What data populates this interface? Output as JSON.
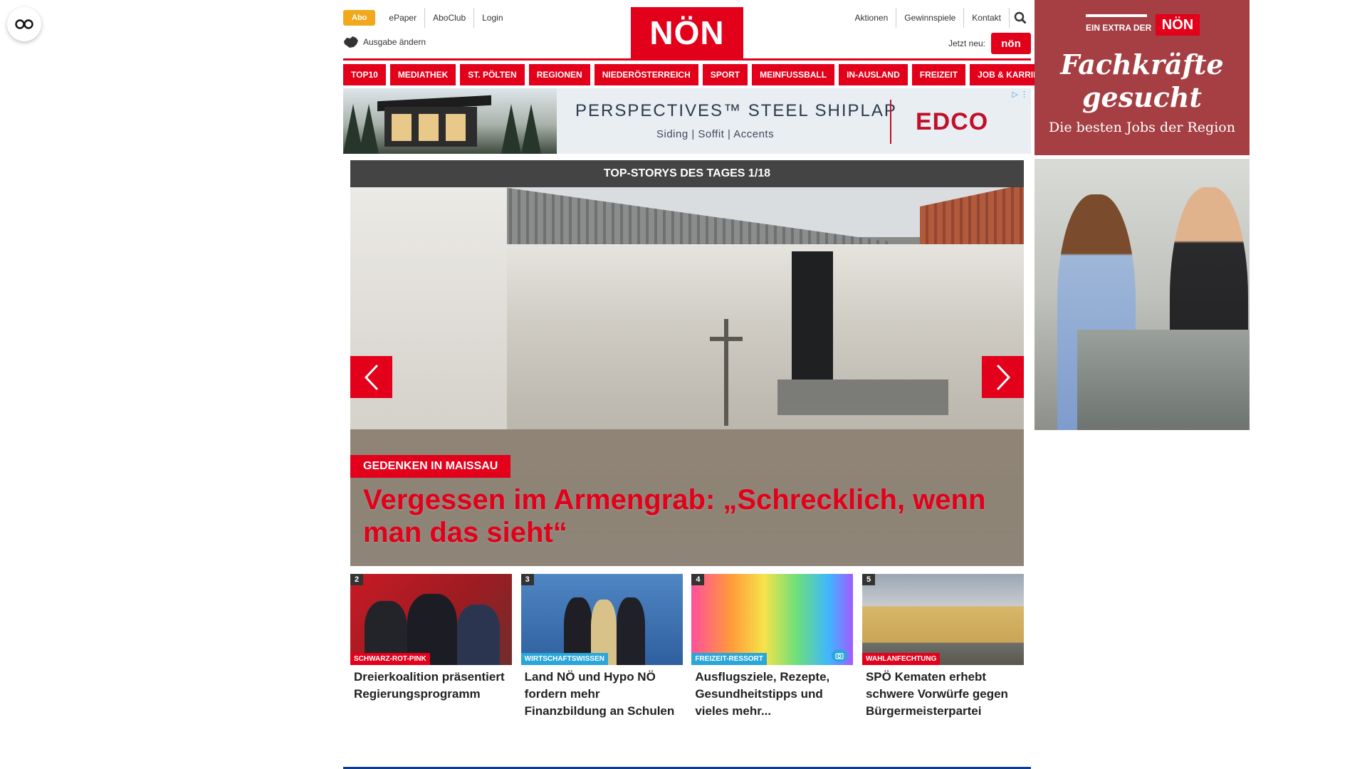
{
  "topbar": {
    "abo": "Abo",
    "left_links": [
      "ePaper",
      "AboClub",
      "Login"
    ],
    "edition": "Ausgabe ändern",
    "right_links": [
      "Aktionen",
      "Gewinnspiele",
      "Kontakt"
    ],
    "jetzt_neu": "Jetzt neu:",
    "jetzt_logo": "nön"
  },
  "logo": "NÖN",
  "nav": [
    "TOP10",
    "MEDIATHEK",
    "ST. PÖLTEN",
    "REGIONEN",
    "NIEDERÖSTERREICH",
    "SPORT",
    "MEINFUSSBALL",
    "IN-AUSLAND",
    "FREIZEIT",
    "JOB & KARRIERE"
  ],
  "ad_banner": {
    "title": "PERSPECTIVES™ STEEL SHIPLAP",
    "subtitle": "Siding | Soffit | Accents",
    "brand": "EDCO"
  },
  "top_stories": {
    "header": "TOP-STORYS DES TAGES 1/18",
    "hero_kicker": "GEDENKEN IN MAISSAU",
    "hero_title": "Vergessen im Armengrab: „Schrecklich, wenn man das sieht“"
  },
  "teasers": [
    {
      "num": "2",
      "kicker": "SCHWARZ-ROT-PINK",
      "title": "Dreierkoalition präsentiert Regierungsprogramm"
    },
    {
      "num": "3",
      "kicker": "WIRTSCHAFTSWISSEN",
      "title": "Land NÖ und Hypo NÖ fordern mehr Finanzbildung an Schulen"
    },
    {
      "num": "4",
      "kicker": "FREIZEIT-RESSORT",
      "title": "Ausflugsziele, Rezepte, Gesundheitstipps und vieles mehr..."
    },
    {
      "num": "5",
      "kicker": "WAHLANFECHTUNG",
      "title": "SPÖ Kematen erhebt schwere Vorwürfe gegen Bürgermeisterpartei"
    }
  ],
  "side_ad": {
    "extra_text": "EIN EXTRA DER",
    "extra_logo": "NÖN",
    "headline_line1": "Fachkräfte",
    "headline_line2": "gesucht",
    "sub": "Die besten Jobs der Region"
  },
  "colors": {
    "brand_red": "#e2001a",
    "abo_orange": "#f2a81c",
    "teaser_blue": "#2aa6d8",
    "sidead_red": "#a53f43"
  }
}
